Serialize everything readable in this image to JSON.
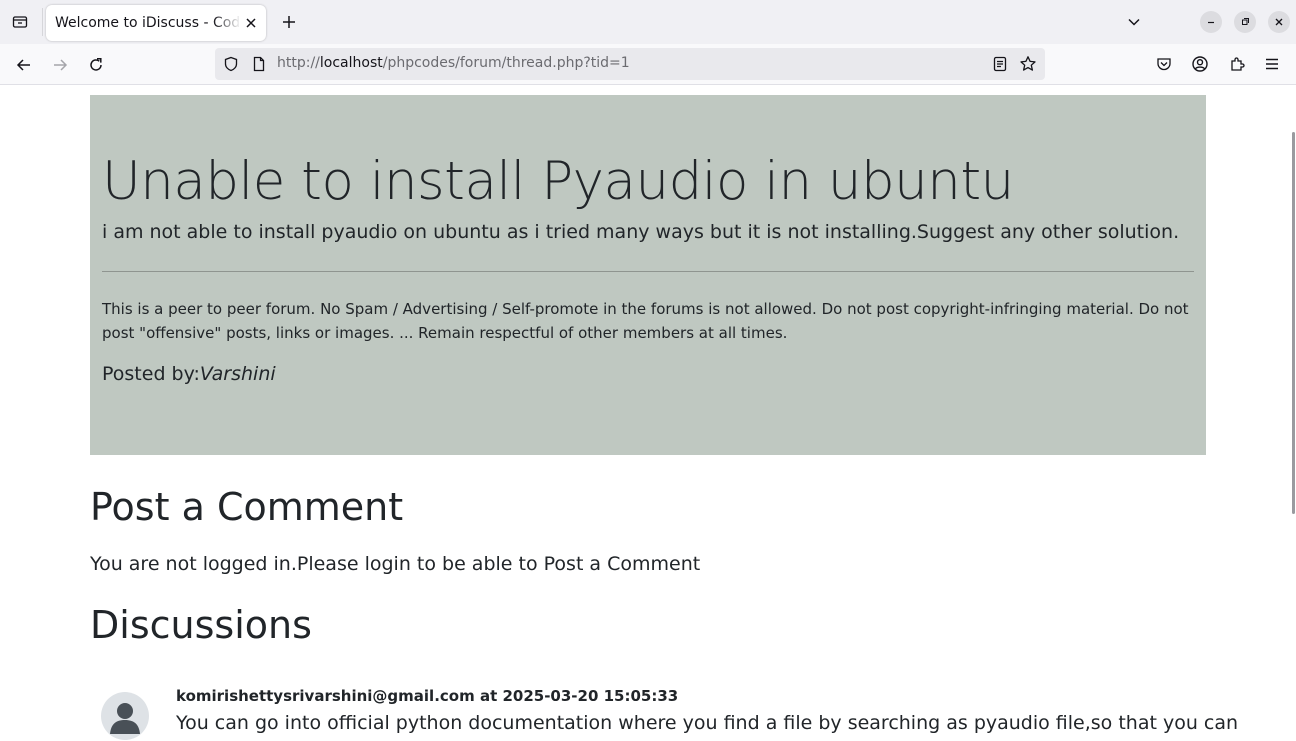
{
  "browser": {
    "tab_title": "Welcome to iDiscuss - Coding Forums",
    "url_prefix": "http://",
    "url_host": "localhost",
    "url_path": "/phpcodes/forum/thread.php?tid=1"
  },
  "thread": {
    "title": "Unable to install Pyaudio in ubuntu",
    "description": "i am not able to install pyaudio on ubuntu as i tried many ways but it is not installing.Suggest any other solution.",
    "rules": "This is a peer to peer forum. No Spam / Advertising / Self-promote in the forums is not allowed. Do not post copyright-infringing material. Do not post \"offensive\" posts, links or images. ... Remain respectful of other members at all times.",
    "posted_by_label": "Posted by:",
    "posted_by_user": "Varshini"
  },
  "comment_section": {
    "heading": "Post a Comment",
    "login_notice": "You are not logged in.Please login to be able to Post a Comment"
  },
  "discussions": {
    "heading": "Discussions",
    "items": [
      {
        "meta": "komirishettysrivarshini@gmail.com at 2025-03-20 15:05:33",
        "body": "You can go into official python documentation where you find a file by searching as pyaudio file,so that you can"
      }
    ]
  },
  "colors": {
    "jumbotron_bg": "#bfc8c1",
    "text": "#212529",
    "chrome_bg": "#f0f0f4"
  }
}
